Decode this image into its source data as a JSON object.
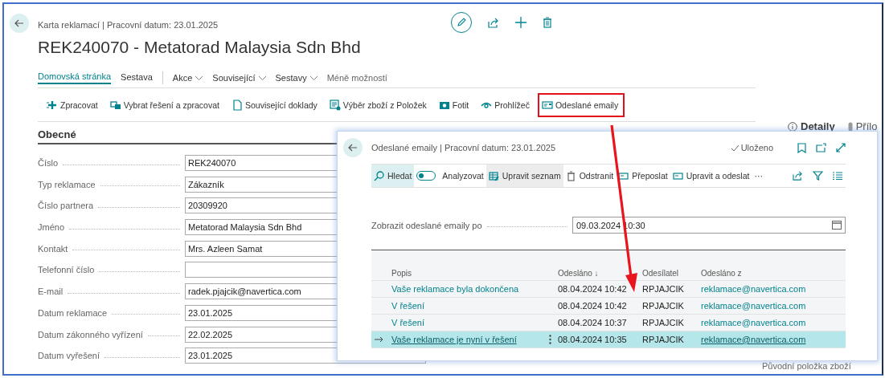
{
  "page": {
    "breadcrumb": "Karta reklamací | Pracovní datum: 23.01.2025",
    "title": "REK240070 - Metatorad Malaysia Sdn Bhd"
  },
  "nav": {
    "tabs": [
      {
        "label": "Domovská stránka",
        "selected": true
      },
      {
        "label": "Sestava",
        "selected": false
      }
    ],
    "menus": [
      "Akce",
      "Související",
      "Sestavy"
    ],
    "less": "Méně možností"
  },
  "actions": [
    {
      "label": "Zpracovat",
      "highlighted": false
    },
    {
      "label": "Vybrat řešení a zpracovat",
      "highlighted": false
    },
    {
      "label": "Související doklady",
      "highlighted": false
    },
    {
      "label": "Výběr zboží z Položek",
      "highlighted": false
    },
    {
      "label": "Fotit",
      "highlighted": false
    },
    {
      "label": "Prohlížeč",
      "highlighted": false
    },
    {
      "label": "Odeslané emaily",
      "highlighted": true
    }
  ],
  "section": {
    "title": "Obecné",
    "fields": [
      {
        "label": "Číslo",
        "value": "REK240070"
      },
      {
        "label": "Typ reklamace",
        "value": "Zákazník"
      },
      {
        "label": "Číslo partnera",
        "value": "20309920"
      },
      {
        "label": "Jméno",
        "value": "Metatorad Malaysia Sdn Bhd"
      },
      {
        "label": "Kontakt",
        "value": "Mrs. Azleen Samat"
      },
      {
        "label": "Telefonní číslo"
      },
      {
        "label": "E-mail",
        "value": "radek.pjajcik@navertica.com"
      },
      {
        "label": "Datum reklamace",
        "value": "23.01.2025"
      },
      {
        "label": "Datum zákonného vyřízení",
        "value": "22.02.2025"
      },
      {
        "label": "Datum vyřešení",
        "value": "23.01.2025"
      }
    ]
  },
  "side_panel": {
    "tabs": [
      {
        "label": "Detaily",
        "selected": true
      },
      {
        "label": "Přílo",
        "selected": false
      }
    ],
    "footer": "Původní položka zboží"
  },
  "dialog": {
    "breadcrumb": "Odeslané emaily | Pracovní datum: 23.01.2025",
    "status": "Uloženo",
    "toolbar": [
      {
        "kind": "search",
        "label": "Hledat",
        "selected": true
      },
      {
        "kind": "toggle",
        "label": "Analyzovat",
        "on": false
      },
      {
        "kind": "edit-list",
        "label": "Upravit seznam",
        "hovered": true
      },
      {
        "kind": "delete",
        "label": "Odstranit",
        "selected": false
      },
      {
        "kind": "forward",
        "label": "Přeposlat",
        "selected": false
      },
      {
        "kind": "edit-send",
        "label": "Upravit a odeslat",
        "selected": false
      },
      {
        "kind": "more",
        "label": "···",
        "selected": false
      }
    ],
    "filter": {
      "label": "Zobrazit odeslané emaily po",
      "value": "09.03.2024 10:30"
    },
    "table": {
      "columns": [
        {
          "label": "Popis"
        },
        {
          "label": "Odesláno",
          "sort": "↓"
        },
        {
          "label": "Odesílatel"
        },
        {
          "label": "Odesláno z"
        }
      ],
      "rows": [
        {
          "cells": [
            "Vaše reklamace byla dokončena",
            "08.04.2024 10:42",
            "RPJAJCIK",
            "reklamace@navertica.com"
          ],
          "selected": false
        },
        {
          "cells": [
            "V řešení",
            "08.04.2024 10:42",
            "RPJAJCIK",
            "reklamace@navertica.com"
          ],
          "selected": false
        },
        {
          "cells": [
            "V řešení",
            "08.04.2024 10:37",
            "RPJAJCIK",
            "reklamace@navertica.com"
          ],
          "selected": false
        },
        {
          "cells": [
            "Vaše reklamace je nyní v řešení",
            "08.04.2024 10:35",
            "RPJAJCIK",
            "reklamace@navertica.com"
          ],
          "selected": true
        }
      ]
    }
  }
}
